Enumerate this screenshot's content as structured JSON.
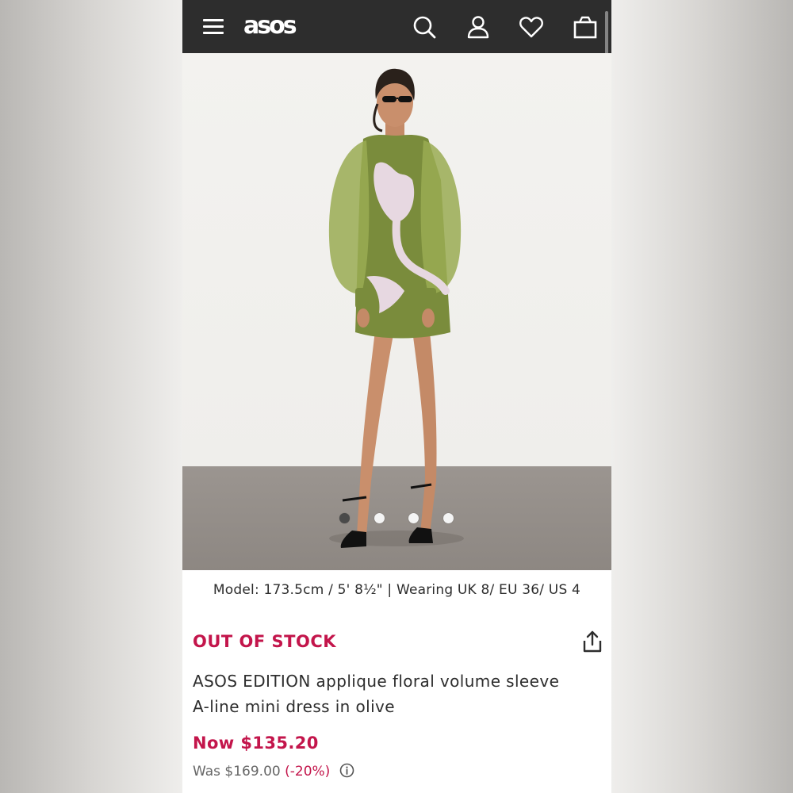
{
  "header": {
    "brand": "asos",
    "icons": [
      "menu-icon",
      "search-icon",
      "account-icon",
      "heart-icon",
      "bag-icon"
    ],
    "background": "#2d2d2d"
  },
  "gallery": {
    "image_count": 4,
    "active_index": 0
  },
  "product": {
    "model_info": "Model: 173.5cm / 5' 8½\" | Wearing UK 8/ EU 36/ US 4",
    "stock_status": "OUT OF STOCK",
    "name_line1": "ASOS EDITION applique floral volume sleeve",
    "name_line2": "A-line mini dress in olive",
    "price_now": "Now $135.20",
    "price_was": "Was $169.00",
    "discount": "(-20%)",
    "accent_color": "#c3154b"
  }
}
